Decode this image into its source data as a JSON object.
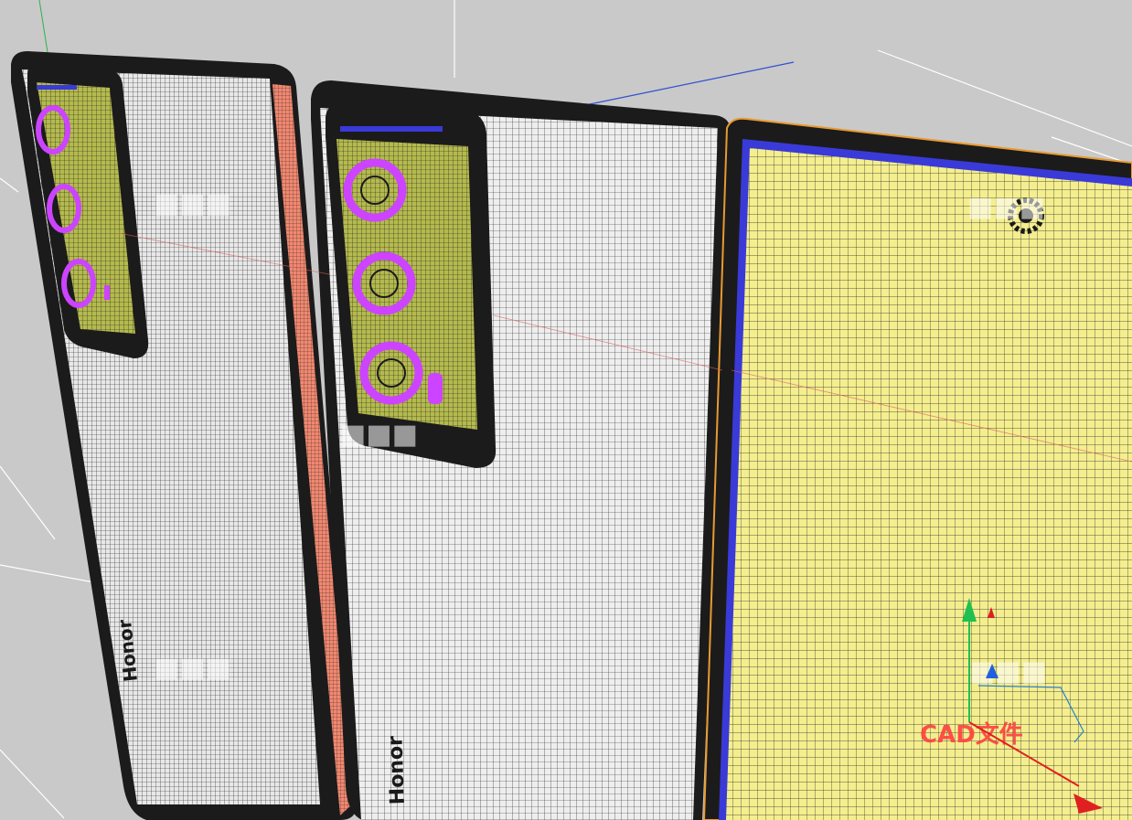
{
  "viewport": {
    "background_color": "#c9c9c9",
    "grid_line_color": "#ffffff",
    "mesh_line_color": "#1a1a1a"
  },
  "models": [
    {
      "name": "phone-back-left",
      "brand_text": "Honor",
      "body_color": "#1b1b1b",
      "panel_color": "#e8e8e8",
      "edge_color": "#f28870",
      "lens_color": "#cc44ff",
      "module_color": "#e8f060"
    },
    {
      "name": "phone-back-center",
      "brand_text": "Honor",
      "body_color": "#1b1b1b",
      "panel_color": "#eeeeee",
      "lens_color": "#cc44ff",
      "module_color": "#e8f060"
    },
    {
      "name": "phone-front-right",
      "body_color": "#1b1b1b",
      "screen_color": "#f4ee8e",
      "bezel_color": "#3a3ad8",
      "outline_color": "#e89a30"
    }
  ],
  "overlay_text": {
    "cad_label": "CAD文件",
    "cad_label_color": "#ff4040"
  },
  "gizmo": {
    "x_axis_color": "#e02020",
    "y_axis_color": "#20c050",
    "z_axis_color": "#2060e0"
  }
}
